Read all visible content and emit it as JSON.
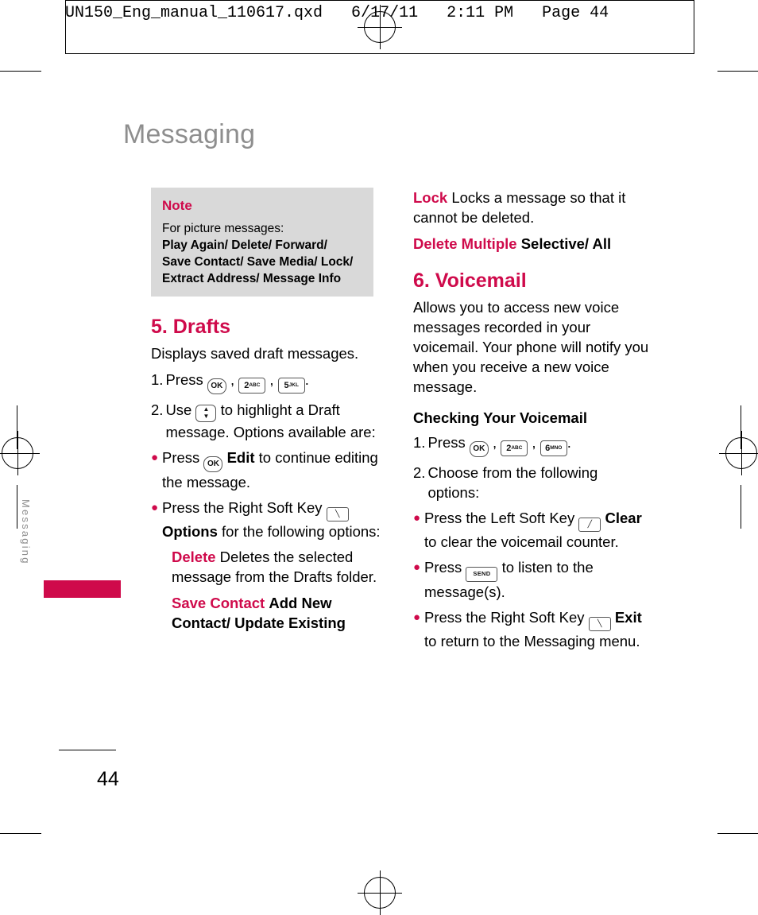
{
  "header": {
    "text": "UN150_Eng_manual_110617.qxd   6/17/11   2:11 PM   Page 44"
  },
  "chapter": {
    "title": "Messaging",
    "side_tab": "Messaging",
    "page_number": "44"
  },
  "note": {
    "title": "Note",
    "intro": "For picture messages:",
    "line1": "Play Again/ Delete/ Forward/",
    "line2": "Save Contact/ Save Media/ Lock/",
    "line3": "Extract Address/ Message Info"
  },
  "drafts": {
    "heading": "5. Drafts",
    "intro": "Displays saved draft messages.",
    "step1_num": "1.",
    "step1_pre": "Press",
    "step1_keys": [
      "OK",
      "2",
      "ABC",
      "5",
      "JKL"
    ],
    "step1_post": ".",
    "step2_num": "2.",
    "step2_pre": "Use",
    "step2_post": "to highlight a Draft message. Options available are:",
    "bullet1_pre": "Press",
    "bullet1_bold": "Edit",
    "bullet1_post": "to continue editing the message.",
    "bullet2_pre": "Press the Right Soft Key",
    "bullet2_bold": "Options",
    "bullet2_post": "for the following options:",
    "delete_kw": "Delete",
    "delete_txt": "Deletes the selected message from the Drafts folder.",
    "save_contact_kw": "Save Contact",
    "save_contact_txt": "Add New Contact/ Update Existing",
    "lock_kw": "Lock",
    "lock_txt": "Locks a message so that it cannot be deleted.",
    "delete_multiple_kw": "Delete Multiple",
    "delete_multiple_txt": "Selective/ All"
  },
  "voicemail": {
    "heading": "6. Voicemail",
    "intro": "Allows you to access new voice messages recorded in your voicemail. Your phone will notify you when you receive a new voice message.",
    "sub_heading": "Checking Your Voicemail",
    "step1_num": "1.",
    "step1_pre": "Press",
    "step1_keys": [
      "OK",
      "2",
      "ABC",
      "6",
      "MNO"
    ],
    "step1_post": ".",
    "step2_num": "2.",
    "step2_txt": "Choose from the following options:",
    "bullet1_pre": "Press the Left Soft Key",
    "bullet1_bold": "Clear",
    "bullet1_post": "to clear the voicemail counter.",
    "bullet2_pre": "Press",
    "bullet2_post": "to listen to the message(s).",
    "bullet3_pre": "Press the Right Soft Key",
    "bullet3_bold": "Exit",
    "bullet3_post": "to return to the Messaging menu.",
    "send_key_label": "SEND"
  },
  "colors": {
    "accent": "#cf0a4b",
    "gray_title": "#8e8e8e",
    "note_bg": "#d9d9d9"
  }
}
